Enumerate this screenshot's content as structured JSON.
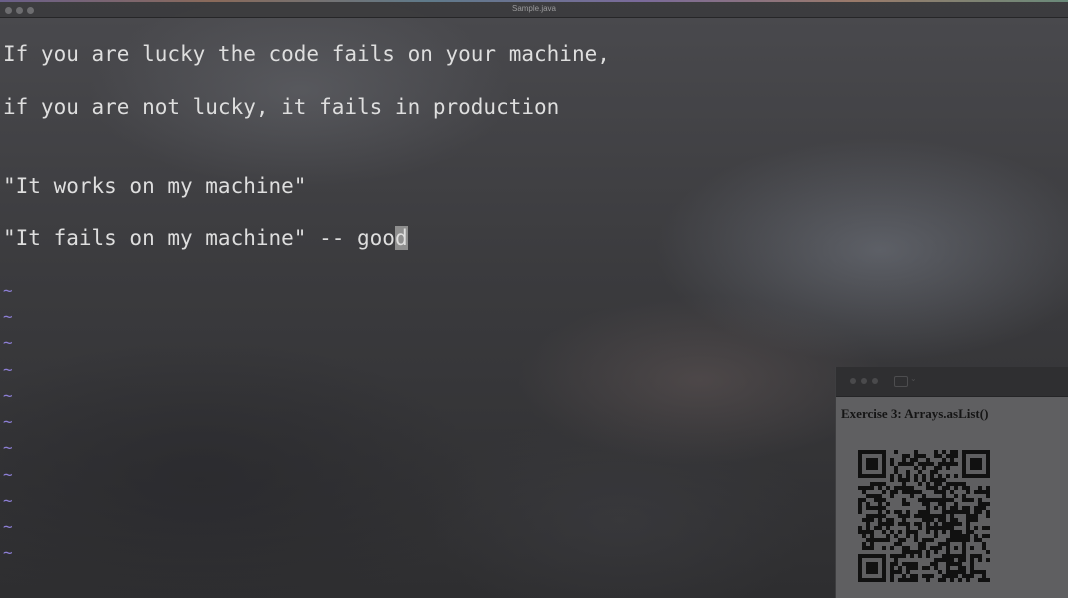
{
  "window": {
    "title": "Sample.java"
  },
  "editor": {
    "lines": [
      "If you are lucky the code fails on your machine,",
      "if you are not lucky, it fails in production",
      "\"It works on my machine\"",
      "\"It fails on my machine\" -- goo"
    ],
    "cursor_char": "d",
    "tilde": "~"
  },
  "panel": {
    "title": "Exercise 3: Arrays.asList()",
    "qr_icon": "qr-code"
  },
  "colors": {
    "tilde": "#8d7fd6",
    "text": "#dedede",
    "cursor": "#8e8e8e"
  }
}
